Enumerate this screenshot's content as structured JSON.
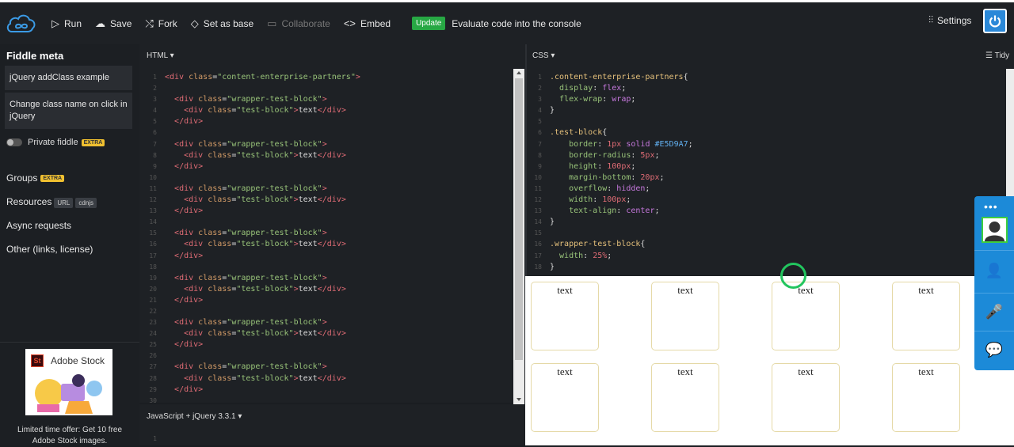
{
  "toolbar": {
    "run": "Run",
    "save": "Save",
    "fork": "Fork",
    "set_as_base": "Set as base",
    "collaborate": "Collaborate",
    "embed": "Embed",
    "update_badge": "Update",
    "update_desc": "Evaluate code into the console",
    "settings": "Settings"
  },
  "sidebar": {
    "title": "Fiddle meta",
    "fiddle_title": "jQuery addClass example",
    "fiddle_desc": "Change class name on click in jQuery",
    "private": "Private fiddle",
    "extra": "EXTRA",
    "groups": "Groups",
    "resources": "Resources",
    "tag_url": "URL",
    "tag_cdnjs": "cdnjs",
    "async": "Async requests",
    "other": "Other (links, license)",
    "ad_brand": "Adobe Stock",
    "ad_logo": "St",
    "ad_text": "Limited time offer: Get 10 free Adobe Stock images."
  },
  "html_panel": {
    "title": "HTML",
    "line_numbers": [
      "1",
      "2",
      "3",
      "4",
      "5",
      "6",
      "7",
      "8",
      "9",
      "10",
      "11",
      "12",
      "13",
      "14",
      "15",
      "16",
      "17",
      "18",
      "19",
      "20",
      "21",
      "22",
      "23",
      "24",
      "25",
      "26",
      "27",
      "28",
      "29",
      "30"
    ]
  },
  "js_panel": {
    "title": "JavaScript + jQuery 3.3.1",
    "line_number": "1"
  },
  "css_panel": {
    "title": "CSS",
    "tidy": "Tidy",
    "line_numbers": [
      "1",
      "2",
      "3",
      "4",
      "5",
      "6",
      "7",
      "8",
      "9",
      "10",
      "11",
      "12",
      "13",
      "14",
      "15",
      "16",
      "17",
      "18"
    ]
  },
  "output": {
    "block_text": "text",
    "block_count": 8
  },
  "colors": {
    "update_green": "#27a844",
    "accent_blue": "#2a88d8",
    "block_border": "#E5D9A7",
    "cursor_ring": "#22c55e"
  }
}
